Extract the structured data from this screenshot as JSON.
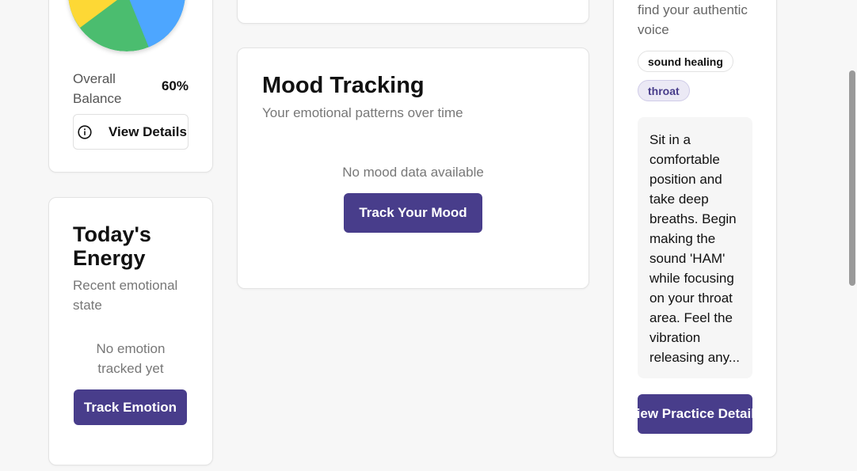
{
  "balance_card": {
    "label": "Overall Balance",
    "value": "60%",
    "button_label": "View Details",
    "pie_colors": [
      "#fdd835",
      "#4bbd6f",
      "#4da6ff"
    ]
  },
  "energy_card": {
    "title": "Today's Energy",
    "subtitle": "Recent emotional state",
    "empty_text": "No emotion tracked yet",
    "button_label": "Track Emotion"
  },
  "mood_card": {
    "title": "Mood Tracking",
    "subtitle": "Your emotional patterns over time",
    "empty_text": "No mood data available",
    "button_label": "Track Your Mood"
  },
  "practice_card": {
    "description": "find your authentic voice",
    "tags": [
      "sound healing",
      "throat"
    ],
    "instructions": "Sit in a comfortable position and take deep breaths. Begin making the sound 'HAM' while focusing on your throat area. Feel the vibration releasing any...",
    "button_label": "View Practice Details"
  },
  "colors": {
    "primary": "#483d8b",
    "background": "#f7f7f7",
    "card": "#ffffff"
  }
}
